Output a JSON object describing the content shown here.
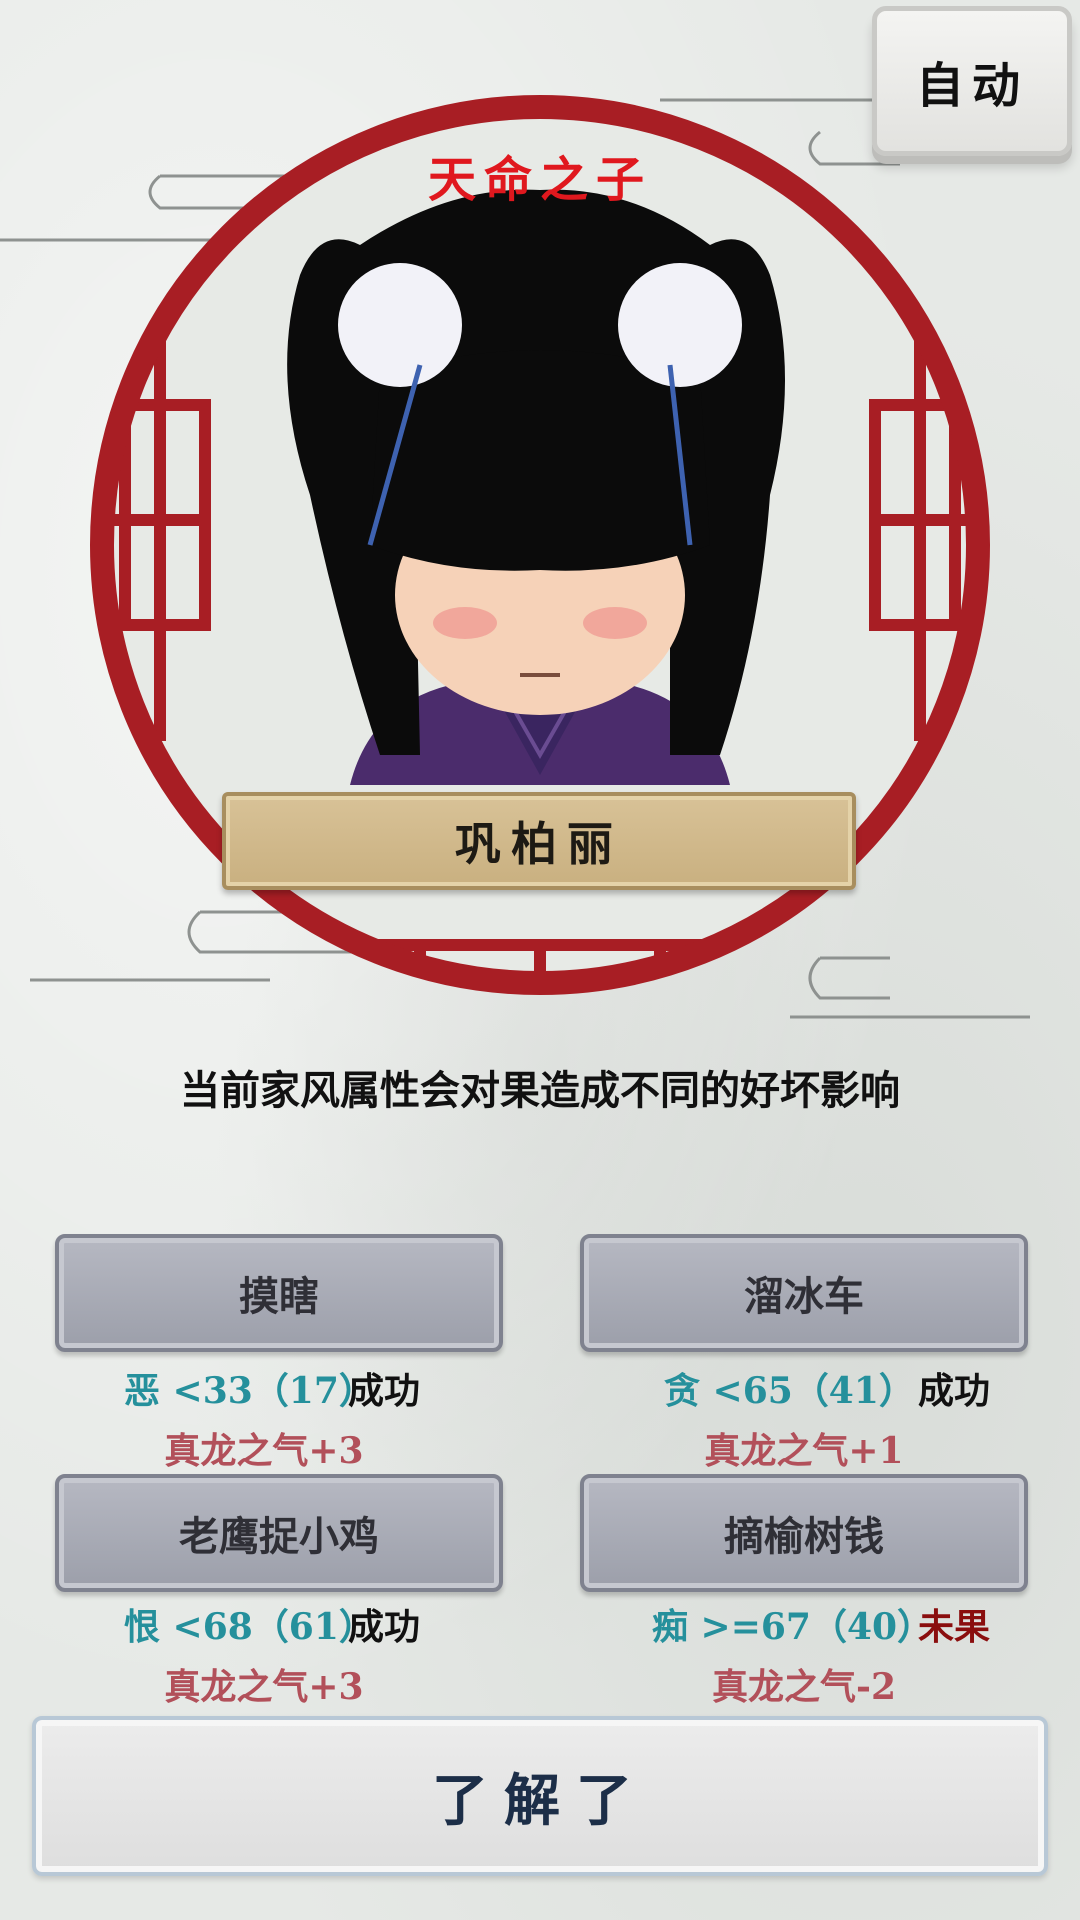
{
  "toolbar": {
    "auto_label": "自动"
  },
  "character": {
    "title": "天命之子",
    "name": "巩柏丽"
  },
  "hint": "当前家风属性会对果造成不同的好坏影响",
  "choices": [
    {
      "label": "摸瞎",
      "condition": "恶 <33（17）",
      "result": "成功",
      "effect": "真龙之气+3"
    },
    {
      "label": "溜冰车",
      "condition": "贪 <65（41）",
      "result": "成功",
      "effect": "真龙之气+1"
    },
    {
      "label": "老鹰捉小鸡",
      "condition": "恨 <68（61）",
      "result": "成功",
      "effect": "真龙之气+3"
    },
    {
      "label": "摘榆树钱",
      "condition": "痴 >=67（40）",
      "result": "未果",
      "effect": "真龙之气-2"
    }
  ],
  "confirm_label": "了解了",
  "colors": {
    "frame_red": "#a81e24",
    "title_red": "#e0181e",
    "condition_teal": "#25909c",
    "effect_rose": "#b2505a",
    "fail_red": "#8a0e0e",
    "plaque_gold": "#cfb78a"
  }
}
